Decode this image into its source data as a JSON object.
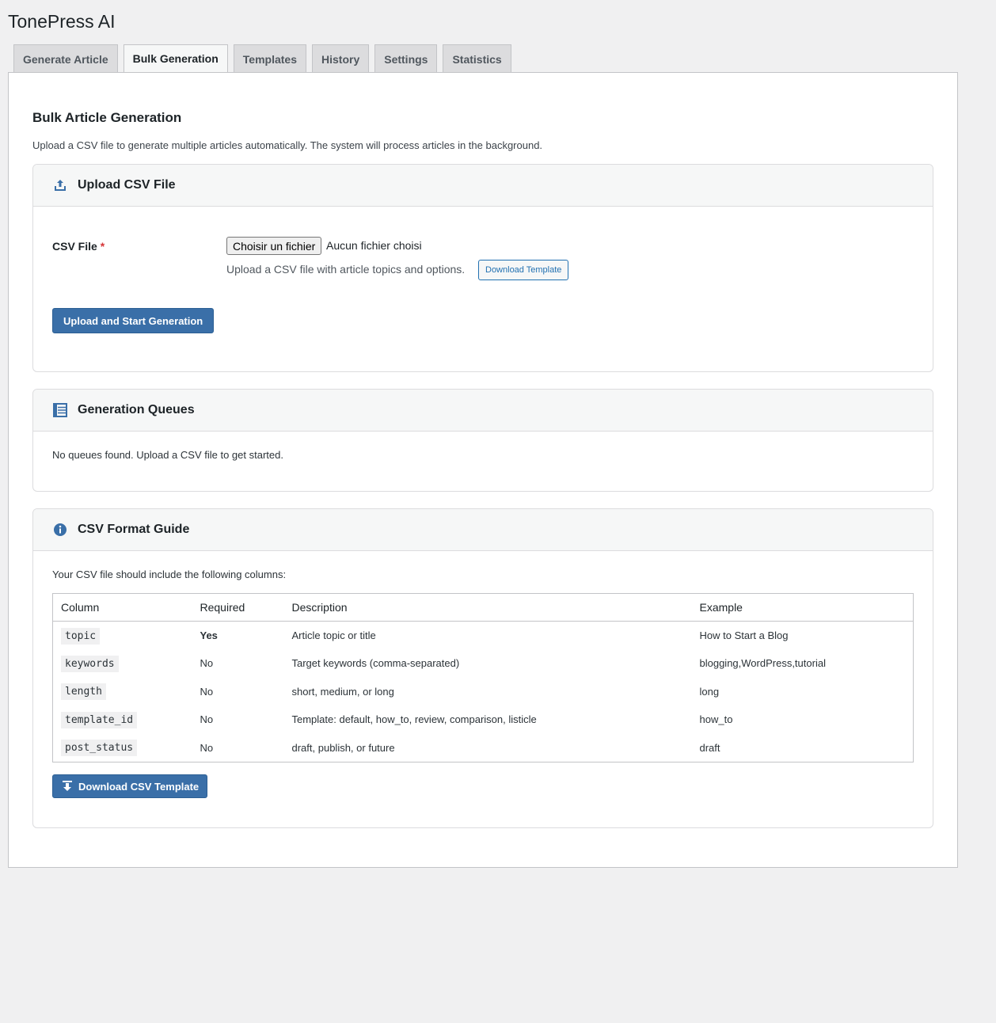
{
  "app": {
    "title": "TonePress AI"
  },
  "tabs": [
    {
      "label": "Generate Article",
      "active": false
    },
    {
      "label": "Bulk Generation",
      "active": true
    },
    {
      "label": "Templates",
      "active": false
    },
    {
      "label": "History",
      "active": false
    },
    {
      "label": "Settings",
      "active": false
    },
    {
      "label": "Statistics",
      "active": false
    }
  ],
  "page": {
    "title": "Bulk Article Generation",
    "description": "Upload a CSV file to generate multiple articles automatically. The system will process articles in the background."
  },
  "upload_card": {
    "title": "Upload CSV File",
    "icon": "upload-icon",
    "field_label": "CSV File",
    "required_mark": "*",
    "file_button": "Choisir un fichier",
    "no_file": "Aucun fichier choisi",
    "help": "Upload a CSV file with article topics and options.",
    "download_template": "Download Template",
    "submit": "Upload and Start Generation"
  },
  "queues_card": {
    "title": "Generation Queues",
    "icon": "list-icon",
    "empty": "No queues found. Upload a CSV file to get started."
  },
  "guide_card": {
    "title": "CSV Format Guide",
    "icon": "info-icon",
    "intro": "Your CSV file should include the following columns:",
    "headers": [
      "Column",
      "Required",
      "Description",
      "Example"
    ],
    "rows": [
      {
        "column": "topic",
        "required": "Yes",
        "description": "Article topic or title",
        "example": "How to Start a Blog"
      },
      {
        "column": "keywords",
        "required": "No",
        "description": "Target keywords (comma-separated)",
        "example": "blogging,WordPress,tutorial"
      },
      {
        "column": "length",
        "required": "No",
        "description": "short, medium, or long",
        "example": "long"
      },
      {
        "column": "template_id",
        "required": "No",
        "description": "Template: default, how_to, review, comparison, listicle",
        "example": "how_to"
      },
      {
        "column": "post_status",
        "required": "No",
        "description": "draft, publish, or future",
        "example": "draft"
      }
    ],
    "download_button": "Download CSV Template"
  },
  "colors": {
    "primary": "#3a6fa8",
    "accent": "#2271b1",
    "required": "#d63638"
  }
}
